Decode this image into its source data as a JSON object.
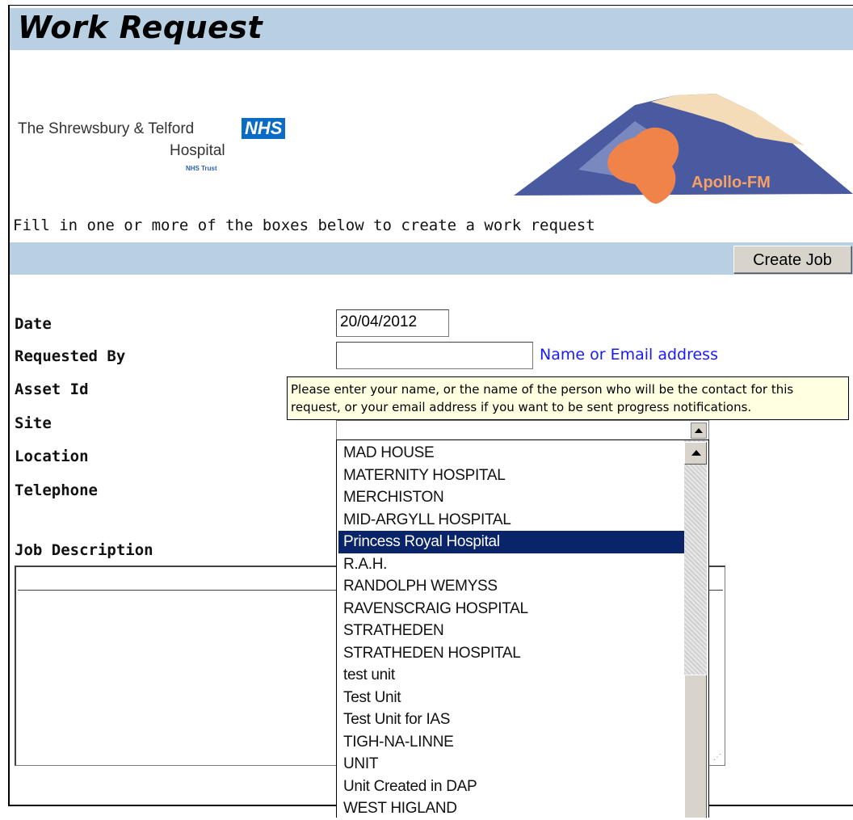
{
  "header": {
    "title": "Work Request"
  },
  "org": {
    "line1": "The Shrewsbury & Telford",
    "nhs": "NHS",
    "line2": "Hospital",
    "trust": "NHS Trust"
  },
  "logo": {
    "text": "Apollo-FM"
  },
  "intro": "Fill in one or more of the boxes below to create a work request",
  "toolbar": {
    "create_label": "Create Job"
  },
  "form": {
    "date_label": "Date",
    "date_value": "20/04/2012",
    "requested_by_label": "Requested By",
    "requested_by_value": "",
    "requested_by_hint": "Name or Email address",
    "asset_label": "Asset Id",
    "site_label": "Site",
    "location_label": "Location",
    "telephone_label": "Telephone",
    "job_desc_label": "Job Description"
  },
  "tooltip": "Please enter your name, or the name of the person who will be the contact for this request, or your email address if you want to be sent progress notifications.",
  "site_dropdown": {
    "options": [
      "MAD HOUSE",
      "MATERNITY HOSPITAL",
      "MERCHISTON",
      "MID-ARGYLL HOSPITAL",
      "Princess Royal Hospital",
      "R.A.H.",
      "RANDOLPH WEMYSS",
      "RAVENSCRAIG HOSPITAL",
      "STRATHEDEN",
      "STRATHEDEN HOSPITAL",
      "test unit",
      "Test Unit",
      "Test Unit for IAS",
      "TIGH-NA-LINNE",
      "UNIT",
      "Unit Created in DAP",
      "WEST HIGLAND"
    ],
    "selected": "Princess Royal Hospital"
  },
  "colors": {
    "header_bg": "#b8d0e2",
    "selection_bg": "#0a246a",
    "hint_text": "#1a1aff",
    "tooltip_bg": "#ffffe1"
  }
}
